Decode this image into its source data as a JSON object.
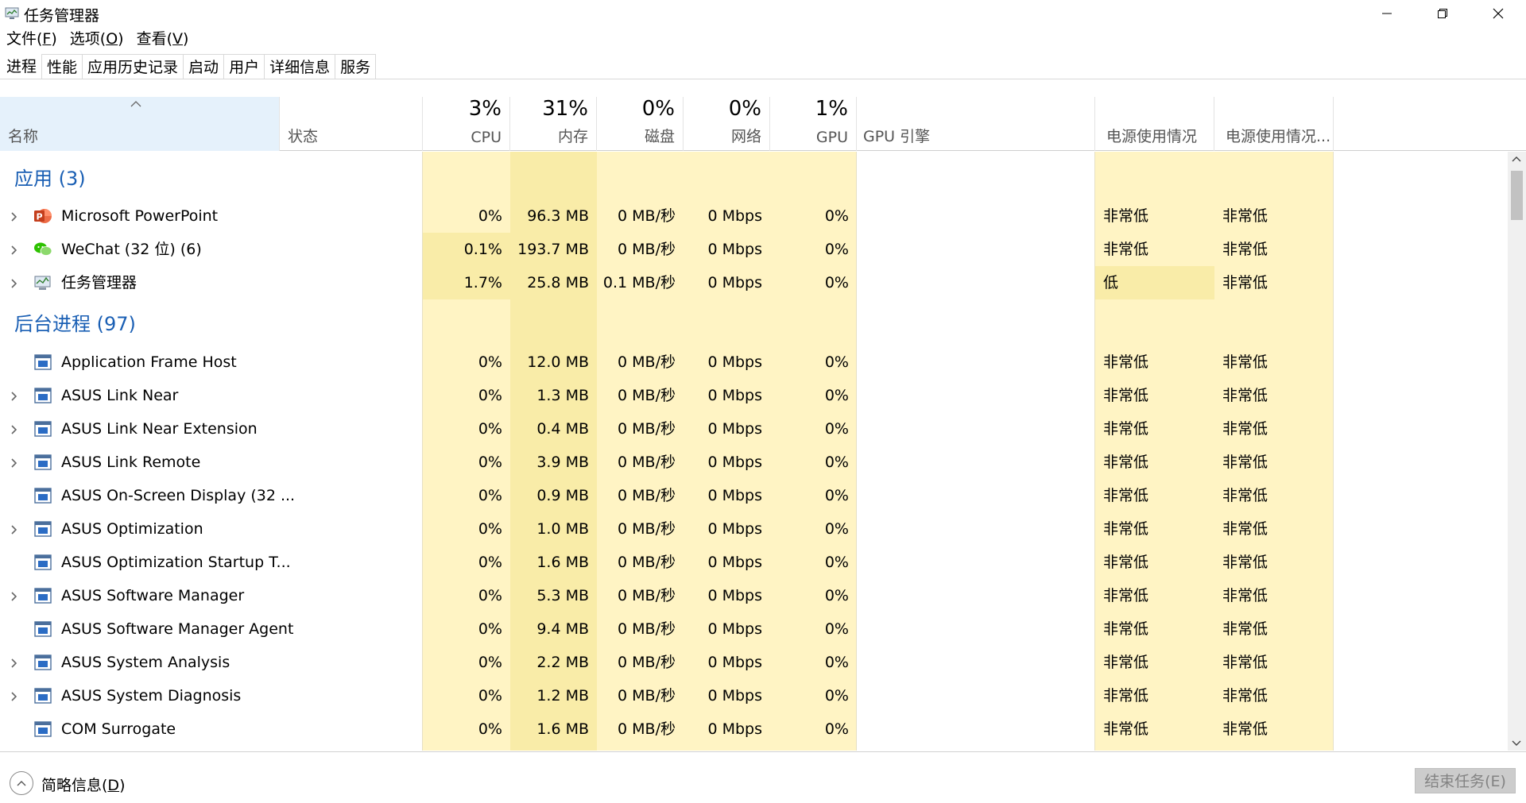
{
  "window": {
    "title": "任务管理器"
  },
  "menu": [
    {
      "label": "文件(",
      "accel": "F",
      "end": ")"
    },
    {
      "label": "选项(",
      "accel": "O",
      "end": ")"
    },
    {
      "label": "查看(",
      "accel": "V",
      "end": ")"
    }
  ],
  "tabs": [
    "进程",
    "性能",
    "应用历史记录",
    "启动",
    "用户",
    "详细信息",
    "服务"
  ],
  "header": {
    "name": "名称",
    "status": "状态",
    "cpu_pct": "3%",
    "cpu": "CPU",
    "mem_pct": "31%",
    "mem": "内存",
    "disk_pct": "0%",
    "disk": "磁盘",
    "net_pct": "0%",
    "net": "网络",
    "gpu_pct": "1%",
    "gpu": "GPU",
    "gpu_engine": "GPU 引擎",
    "power": "电源使用情况",
    "power_trend": "电源使用情况..."
  },
  "groups": {
    "apps": "应用 (3)",
    "background": "后台进程 (97)"
  },
  "apps": [
    {
      "name": "Microsoft PowerPoint",
      "icon": "powerpoint-icon",
      "expand": true,
      "cpu": "0%",
      "mem": "96.3 MB",
      "disk": "0 MB/秒",
      "net": "0 Mbps",
      "gpu": "0%",
      "power": "非常低",
      "trend": "非常低"
    },
    {
      "name": "WeChat (32 位) (6)",
      "icon": "wechat-icon",
      "expand": true,
      "cpu": "0.1%",
      "mem": "193.7 MB",
      "disk": "0 MB/秒",
      "net": "0 Mbps",
      "gpu": "0%",
      "power": "非常低",
      "trend": "非常低"
    },
    {
      "name": "任务管理器",
      "icon": "task-manager-icon",
      "expand": true,
      "cpu": "1.7%",
      "mem": "25.8 MB",
      "disk": "0.1 MB/秒",
      "net": "0 Mbps",
      "gpu": "0%",
      "power": "低",
      "trend": "非常低"
    }
  ],
  "background": [
    {
      "name": "Application Frame Host",
      "expand": false,
      "cpu": "0%",
      "mem": "12.0 MB",
      "disk": "0 MB/秒",
      "net": "0 Mbps",
      "gpu": "0%",
      "power": "非常低",
      "trend": "非常低"
    },
    {
      "name": "ASUS Link Near",
      "expand": true,
      "cpu": "0%",
      "mem": "1.3 MB",
      "disk": "0 MB/秒",
      "net": "0 Mbps",
      "gpu": "0%",
      "power": "非常低",
      "trend": "非常低"
    },
    {
      "name": "ASUS Link Near Extension",
      "expand": true,
      "cpu": "0%",
      "mem": "0.4 MB",
      "disk": "0 MB/秒",
      "net": "0 Mbps",
      "gpu": "0%",
      "power": "非常低",
      "trend": "非常低"
    },
    {
      "name": "ASUS Link Remote",
      "expand": true,
      "cpu": "0%",
      "mem": "3.9 MB",
      "disk": "0 MB/秒",
      "net": "0 Mbps",
      "gpu": "0%",
      "power": "非常低",
      "trend": "非常低"
    },
    {
      "name": "ASUS On-Screen Display (32 ...",
      "expand": false,
      "cpu": "0%",
      "mem": "0.9 MB",
      "disk": "0 MB/秒",
      "net": "0 Mbps",
      "gpu": "0%",
      "power": "非常低",
      "trend": "非常低"
    },
    {
      "name": "ASUS Optimization",
      "expand": true,
      "cpu": "0%",
      "mem": "1.0 MB",
      "disk": "0 MB/秒",
      "net": "0 Mbps",
      "gpu": "0%",
      "power": "非常低",
      "trend": "非常低"
    },
    {
      "name": "ASUS Optimization Startup T...",
      "expand": false,
      "cpu": "0%",
      "mem": "1.6 MB",
      "disk": "0 MB/秒",
      "net": "0 Mbps",
      "gpu": "0%",
      "power": "非常低",
      "trend": "非常低"
    },
    {
      "name": "ASUS Software Manager",
      "expand": true,
      "cpu": "0%",
      "mem": "5.3 MB",
      "disk": "0 MB/秒",
      "net": "0 Mbps",
      "gpu": "0%",
      "power": "非常低",
      "trend": "非常低"
    },
    {
      "name": "ASUS Software Manager Agent",
      "expand": false,
      "cpu": "0%",
      "mem": "9.4 MB",
      "disk": "0 MB/秒",
      "net": "0 Mbps",
      "gpu": "0%",
      "power": "非常低",
      "trend": "非常低"
    },
    {
      "name": "ASUS System Analysis",
      "expand": true,
      "cpu": "0%",
      "mem": "2.2 MB",
      "disk": "0 MB/秒",
      "net": "0 Mbps",
      "gpu": "0%",
      "power": "非常低",
      "trend": "非常低"
    },
    {
      "name": "ASUS System Diagnosis",
      "expand": true,
      "cpu": "0%",
      "mem": "1.2 MB",
      "disk": "0 MB/秒",
      "net": "0 Mbps",
      "gpu": "0%",
      "power": "非常低",
      "trend": "非常低"
    },
    {
      "name": "COM Surrogate",
      "expand": false,
      "cpu": "0%",
      "mem": "1.6 MB",
      "disk": "0 MB/秒",
      "net": "0 Mbps",
      "gpu": "0%",
      "power": "非常低",
      "trend": "非常低"
    }
  ],
  "footer": {
    "fewer_details": "简略信息(",
    "fewer_accel": "D",
    "fewer_end": ")",
    "end_task": "结束任务(E)"
  },
  "colors": {
    "heat_light": "#fff4c4",
    "heat_mid": "#f9eca8",
    "group_blue": "#1a5fb4",
    "name_header_bg": "#e5f1fb"
  }
}
